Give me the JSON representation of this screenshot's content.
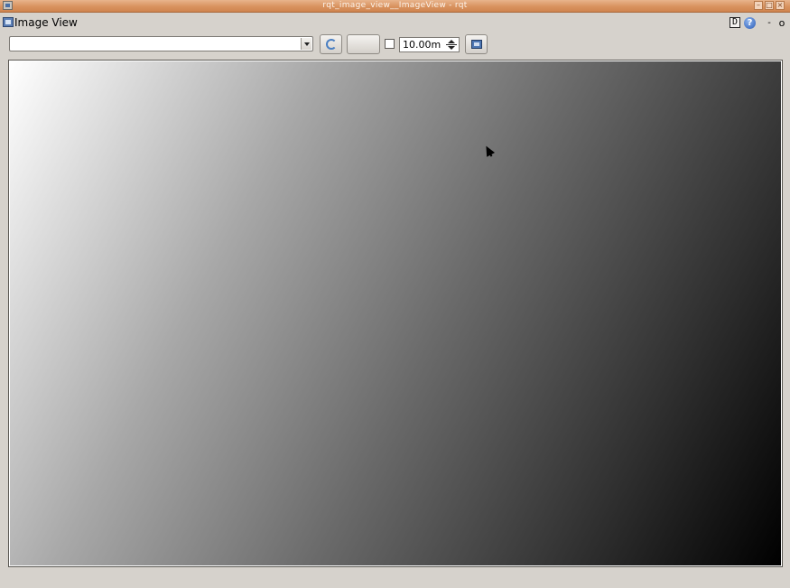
{
  "window": {
    "title": "rqt_image_view__ImageView - rqt",
    "min_label": "–",
    "max_label": "□",
    "close_label": "×"
  },
  "dock": {
    "title": "Image View",
    "d_label": "D",
    "help_label": "?",
    "dash_label": "-",
    "close_label": "o"
  },
  "toolbar": {
    "topic_value": "",
    "zoom_label": "",
    "smooth_checked": false,
    "spin_value": "10.00m"
  },
  "colors": {
    "titlebar": "#d9935f",
    "background": "#d6d2cc"
  }
}
